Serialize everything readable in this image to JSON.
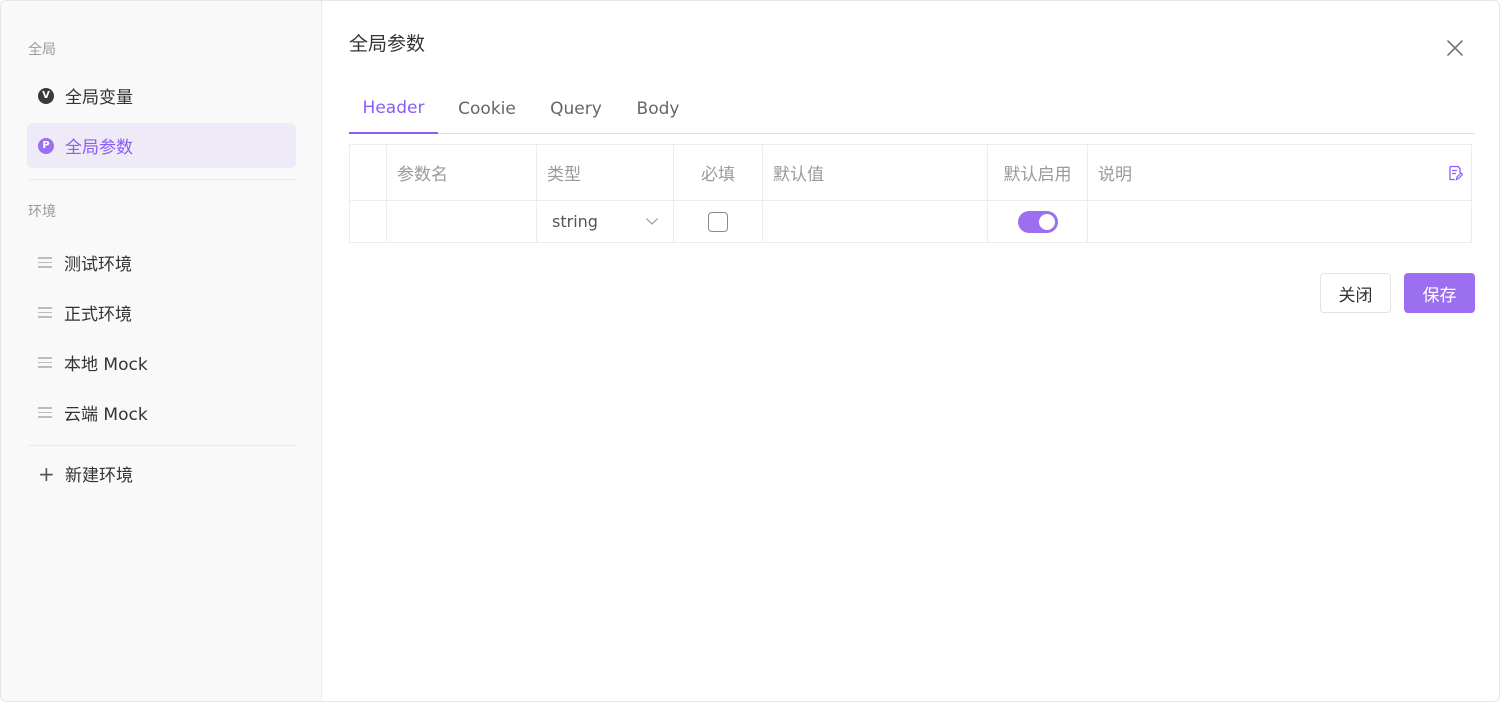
{
  "sidebar": {
    "global_label": "全局",
    "env_label": "环境",
    "global_items": [
      {
        "label": "全局变量",
        "badge": "V",
        "icon": "variable-icon"
      },
      {
        "label": "全局参数",
        "badge": "P",
        "icon": "parameter-icon"
      }
    ],
    "env_items": [
      {
        "label": "测试环境"
      },
      {
        "label": "正式环境"
      },
      {
        "label": "本地 Mock"
      },
      {
        "label": "云端 Mock"
      }
    ],
    "new_env_label": "新建环境"
  },
  "main": {
    "title": "全局参数",
    "tabs": [
      {
        "label": "Header",
        "active": true
      },
      {
        "label": "Cookie"
      },
      {
        "label": "Query"
      },
      {
        "label": "Body"
      }
    ],
    "table": {
      "headers": [
        "参数名",
        "类型",
        "必填",
        "默认值",
        "默认启用",
        "说明"
      ],
      "row": {
        "name": "",
        "type": "string",
        "required": false,
        "default_value": "",
        "enabled": true,
        "description": ""
      }
    },
    "buttons": {
      "close": "关闭",
      "save": "保存"
    }
  },
  "colors": {
    "accent": "#9b6ff0",
    "active_bg": "#eeeaf8"
  }
}
